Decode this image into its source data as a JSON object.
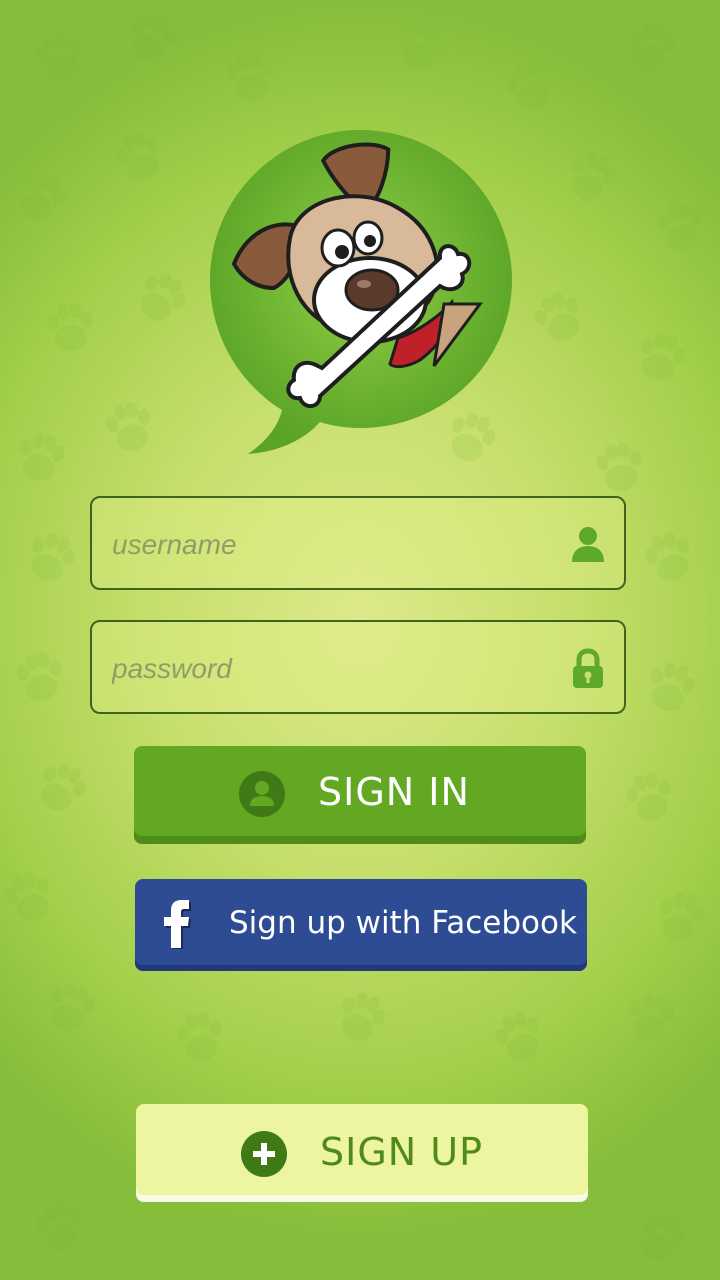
{
  "login": {
    "username_placeholder": "username",
    "password_placeholder": "password",
    "sign_in_label": "SIGN IN",
    "facebook_label": "Sign up with Facebook",
    "sign_up_label": "SIGN UP"
  },
  "icons": {
    "logo": "dog-with-bone-logo",
    "username_field": "user-icon",
    "password_field": "lock-icon",
    "sign_in": "user-circle-icon",
    "facebook": "facebook-f-icon",
    "sign_up": "plus-circle-icon"
  },
  "colors": {
    "background": "#a3cf4a",
    "sign_in_button": "#62a823",
    "facebook_button": "#2e4c94",
    "sign_up_button": "#eef5a0",
    "sign_up_text": "#4f8a1b"
  }
}
